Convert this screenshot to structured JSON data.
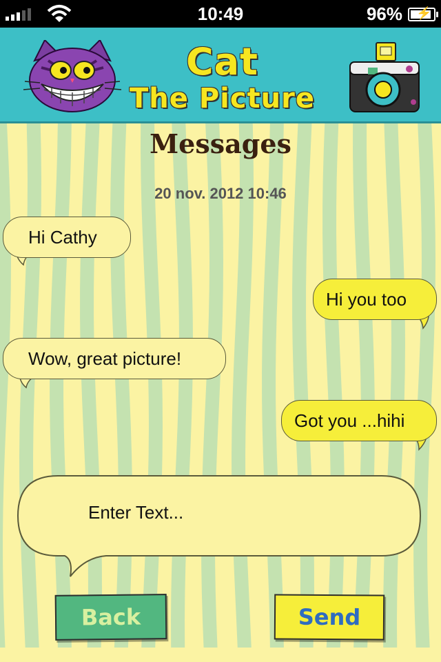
{
  "status_bar": {
    "time": "10:49",
    "battery_percent": "96%",
    "battery_level": 0.96
  },
  "header": {
    "title_line1": "Cat",
    "title_line2": "The Picture"
  },
  "screen": {
    "heading": "Messages",
    "date": "20 nov. 2012 10:46"
  },
  "messages": [
    {
      "text": "Hi Cathy",
      "direction": "incoming"
    },
    {
      "text": "Hi you too",
      "direction": "outgoing"
    },
    {
      "text": "Wow, great picture!",
      "direction": "incoming"
    },
    {
      "text": "Got you ...hihi",
      "direction": "outgoing"
    }
  ],
  "composer": {
    "placeholder": "Enter Text..."
  },
  "buttons": {
    "back_label": "Back",
    "send_label": "Send"
  },
  "colors": {
    "header": "#3dbfc6",
    "stripe_light": "#fbf3a3",
    "stripe_green": "#c4e2b0",
    "bubble_outgoing": "#f6ee3a",
    "back_button": "#52b780",
    "send_text": "#2f6cc0"
  }
}
